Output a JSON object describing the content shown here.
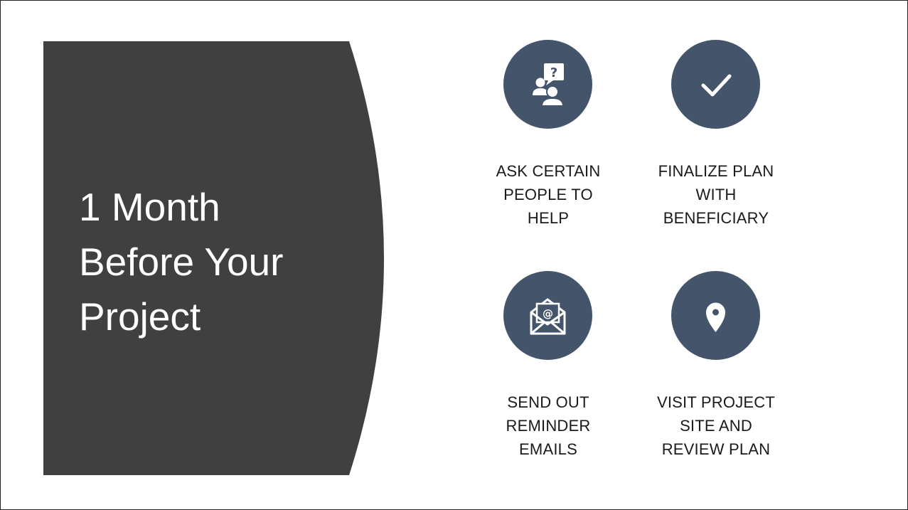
{
  "slide": {
    "title_lines": [
      "1 Month",
      "Before Your",
      "Project"
    ],
    "colors": {
      "panel": "#404040",
      "accent": "#44546a",
      "border": "#222222"
    },
    "tiles": [
      {
        "icon": "ask-people-icon",
        "label_lines": [
          "ASK CERTAIN",
          "PEOPLE TO",
          "HELP"
        ]
      },
      {
        "icon": "checkmark-icon",
        "label_lines": [
          "FINALIZE PLAN",
          "WITH",
          "BENEFICIARY"
        ]
      },
      {
        "icon": "email-envelope-icon",
        "label_lines": [
          "SEND OUT",
          "REMINDER",
          "EMAILS"
        ]
      },
      {
        "icon": "map-pin-icon",
        "label_lines": [
          "VISIT PROJECT",
          "SITE AND",
          "REVIEW PLAN"
        ]
      }
    ]
  }
}
